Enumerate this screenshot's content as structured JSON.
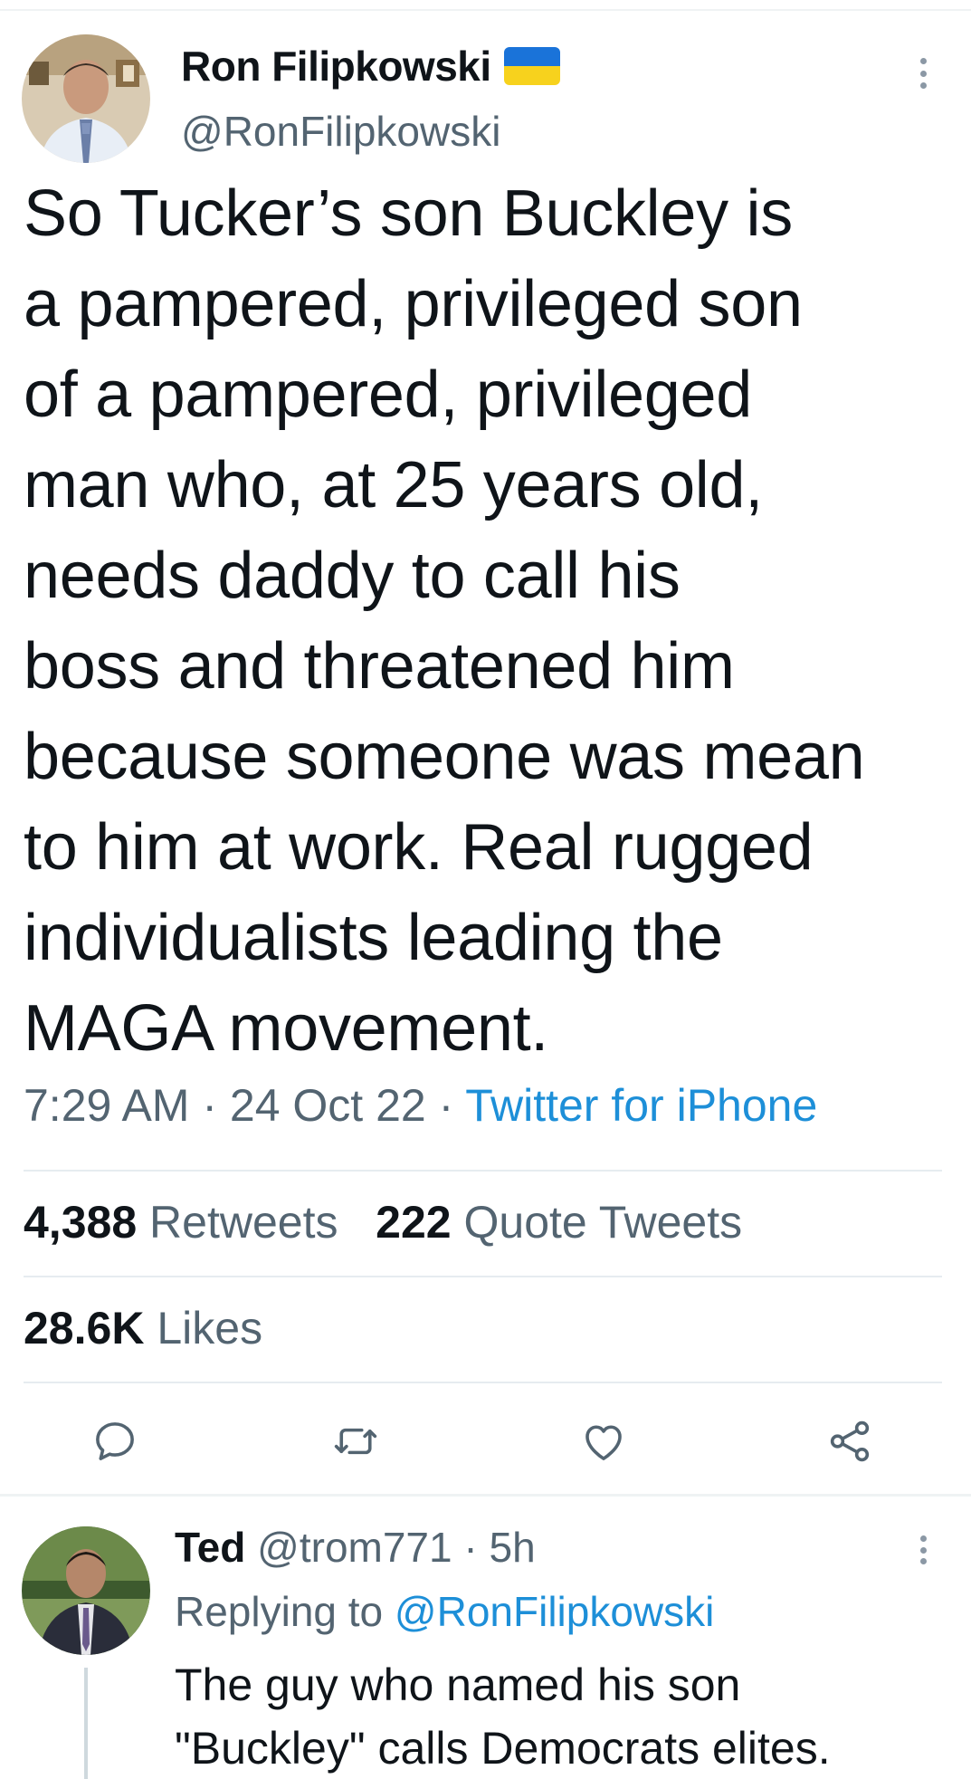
{
  "tweet": {
    "author_name": "Ron Filipkowski",
    "handle": "@RonFilipkowski",
    "text": "So Tucker’s son Buckley is\na pampered, privileged son\nof a pampered, privileged\nman who, at 25 years old,\nneeds daddy to call his\nboss and threatened him\nbecause someone was mean\nto him at work. Real rugged\nindividualists leading the\nMAGA movement.",
    "time": "7:29 AM",
    "date": "24 Oct 22",
    "separator": " · ",
    "source": "Twitter for iPhone",
    "retweets_count": "4,388",
    "retweets_label": "Retweets",
    "quotes_count": "222",
    "quotes_label": "Quote Tweets",
    "likes_count": "28.6K",
    "likes_label": "Likes",
    "flag_colors": [
      "#1a73d9",
      "#f7d21d"
    ]
  },
  "actions": [
    "reply-icon",
    "retweet-icon",
    "like-icon",
    "share-icon"
  ],
  "reply": {
    "author_name": "Ted",
    "handle": "@trom771",
    "separator": " · ",
    "time_ago": "5h",
    "replying_prefix": "Replying to",
    "replying_to": "@RonFilipkowski",
    "text": "The guy who named his son\n\"Buckley\" calls Democrats elites."
  },
  "colors": {
    "text": "#0f1419",
    "secondary": "#536471",
    "link": "#1d8fd8",
    "divider": "#eff3f4"
  }
}
